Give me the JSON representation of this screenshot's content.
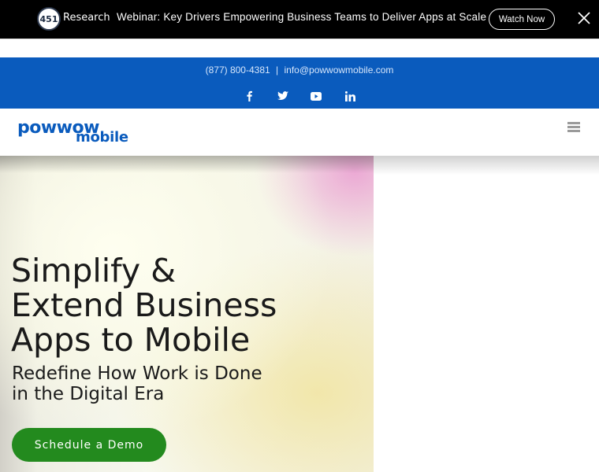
{
  "promo": {
    "logo_badge": "451",
    "brand": "Research",
    "message": "Webinar: Key Drivers Empowering Business Teams to Deliver Apps at Scale",
    "button_label": "Watch Now",
    "close_icon": "close-icon"
  },
  "contact": {
    "phone": "(877) 800-4381",
    "separator": "|",
    "email": "info@powwowmobile.com",
    "social": [
      "facebook-icon",
      "twitter-icon",
      "youtube-icon",
      "linkedin-icon"
    ]
  },
  "header": {
    "logo_line1": "powwow",
    "logo_line2": "mobile",
    "menu_icon": "hamburger-menu-icon"
  },
  "hero": {
    "headline": "Simplify & Extend Business Apps to Mobile",
    "subheadline": "Redefine How Work is Done in the Digital Era",
    "cta_label": "Schedule a Demo"
  },
  "colors": {
    "brand_blue": "#0a5bbd",
    "cta_green": "#238a1e",
    "promo_bg": "#000000"
  }
}
